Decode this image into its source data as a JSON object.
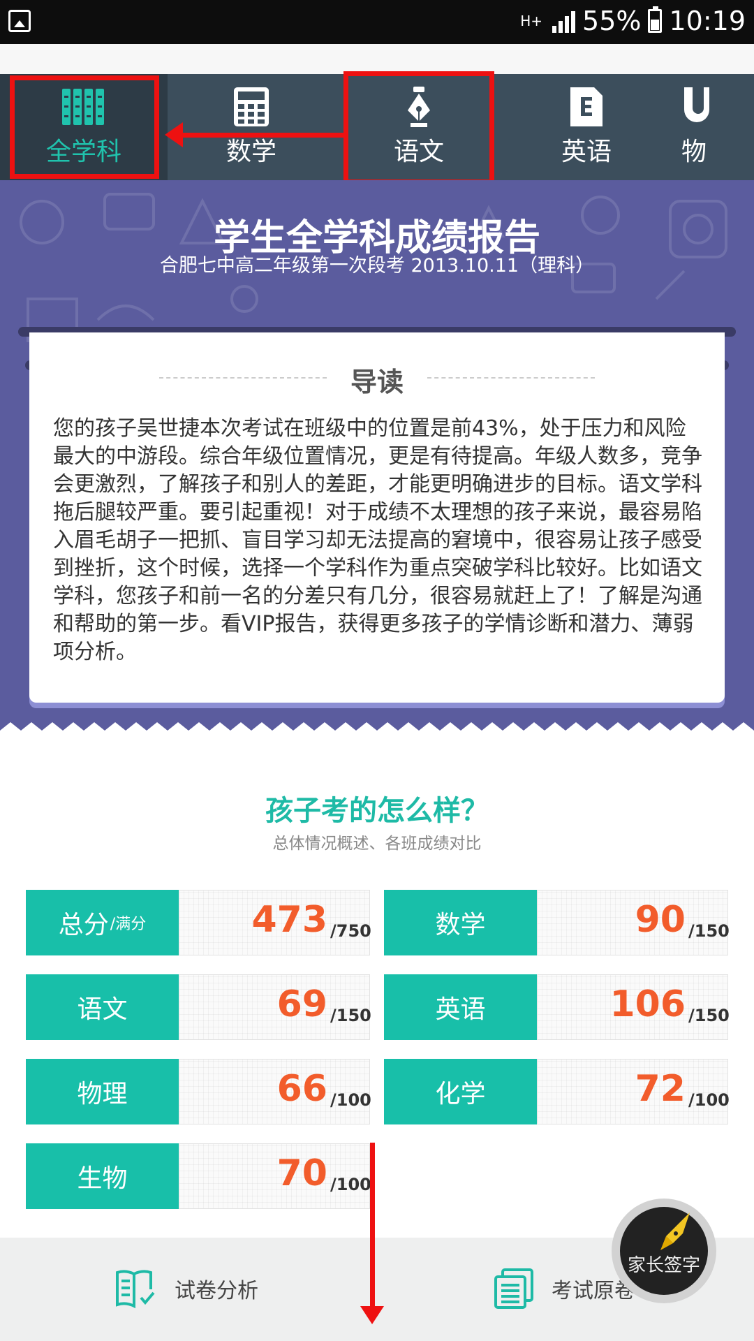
{
  "status_bar": {
    "network": "H+",
    "battery": "55%",
    "time": "10:19"
  },
  "tabs": [
    {
      "label": "全学科",
      "icon": "books-icon",
      "active": true
    },
    {
      "label": "数学",
      "icon": "calculator-icon",
      "active": false
    },
    {
      "label": "语文",
      "icon": "pen-nib-icon",
      "active": false
    },
    {
      "label": "英语",
      "icon": "english-doc-icon",
      "active": false
    },
    {
      "label": "物",
      "icon": "magnet-icon",
      "active": false
    }
  ],
  "report": {
    "title": "学生全学科成绩报告",
    "subtitle": "合肥七中高二年级第一次段考 2013.10.11（理科）"
  },
  "guide": {
    "title": "导读",
    "text": "您的孩子吴世捷本次考试在班级中的位置是前43%，处于压力和风险最大的中游段。综合年级位置情况，更是有待提高。年级人数多，竞争会更激烈，了解孩子和别人的差距，才能更明确进步的目标。语文学科拖后腿较严重。要引起重视！对于成绩不太理想的孩子来说，最容易陷入眉毛胡子一把抓、盲目学习却无法提高的窘境中，很容易让孩子感受到挫折，这个时候，选择一个学科作为重点突破学科比较好。比如语文学科，您孩子和前一名的分差只有几分，很容易就赶上了！了解是沟通和帮助的第一步。看VIP报告，获得更多孩子的学情诊断和潜力、薄弱项分析。"
  },
  "section": {
    "title": "孩子考的怎么样？",
    "subtitle": "总体情况概述、各班成绩对比"
  },
  "scores": [
    {
      "label": "总分",
      "label_suffix": "/满分",
      "score": "473",
      "max": "/750"
    },
    {
      "label": "数学",
      "label_suffix": "",
      "score": "90",
      "max": "/150"
    },
    {
      "label": "语文",
      "label_suffix": "",
      "score": "69",
      "max": "/150"
    },
    {
      "label": "英语",
      "label_suffix": "",
      "score": "106",
      "max": "/150"
    },
    {
      "label": "物理",
      "label_suffix": "",
      "score": "66",
      "max": "/100"
    },
    {
      "label": "化学",
      "label_suffix": "",
      "score": "72",
      "max": "/100"
    },
    {
      "label": "生物",
      "label_suffix": "",
      "score": "70",
      "max": "/100"
    }
  ],
  "bottom": {
    "paper_analysis": "试卷分析",
    "original_paper": "考试原卷",
    "parent_sign": "家长签字"
  },
  "colors": {
    "accent": "#18bfa9",
    "score": "#f25c2b",
    "tab_bg": "#3c4e5c",
    "banner": "#5b5c9e",
    "annotation": "#ee1111"
  }
}
